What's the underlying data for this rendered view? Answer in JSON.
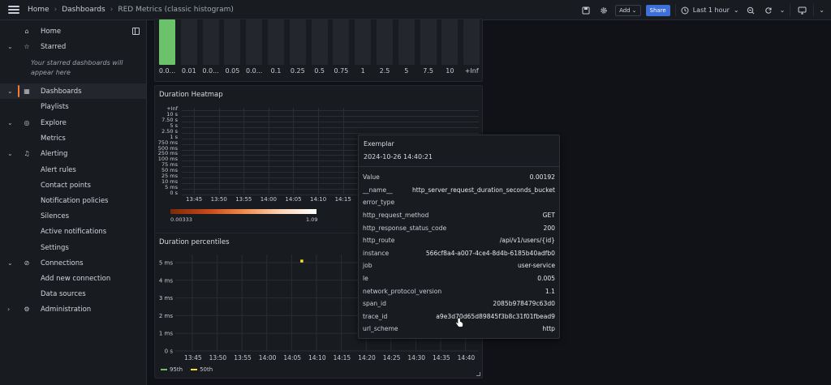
{
  "topbar": {
    "breadcrumbs": [
      "Home",
      "Dashboards",
      "RED Metrics (classic histogram)"
    ],
    "add_label": "Add",
    "share_label": "Share",
    "time_range": "Last 1 hour"
  },
  "sidebar": {
    "starred_note": "Your starred dashboards will appear here",
    "items": [
      {
        "label": "Home"
      },
      {
        "label": "Starred"
      },
      {
        "label": "Dashboards"
      },
      {
        "label": "Playlists"
      },
      {
        "label": "Explore"
      },
      {
        "label": "Metrics"
      },
      {
        "label": "Alerting"
      },
      {
        "label": "Alert rules"
      },
      {
        "label": "Contact points"
      },
      {
        "label": "Notification policies"
      },
      {
        "label": "Silences"
      },
      {
        "label": "Active notifications"
      },
      {
        "label": "Settings"
      },
      {
        "label": "Connections"
      },
      {
        "label": "Add new connection"
      },
      {
        "label": "Data sources"
      },
      {
        "label": "Administration"
      }
    ]
  },
  "bucket_panel": {
    "labels": [
      "0.0...",
      "0.01",
      "0.0...",
      "0.05",
      "0.0...",
      "0.1",
      "0.25",
      "0.5",
      "0.75",
      "1",
      "2.5",
      "5",
      "7.5",
      "10",
      "+Inf"
    ],
    "fills": [
      1,
      0,
      0,
      0,
      0,
      0,
      0,
      0,
      0,
      0,
      0,
      0,
      0,
      0,
      0
    ]
  },
  "heatmap": {
    "title": "Duration Heatmap",
    "yticks": [
      "+Inf",
      "10 s",
      "7.50 s",
      "5 s",
      "2.50 s",
      "1 s",
      "750 ms",
      "500 ms",
      "250 ms",
      "100 ms",
      "75 ms",
      "50 ms",
      "25 ms",
      "10 ms",
      "5 ms",
      "0 s"
    ],
    "xticks": [
      "13:45",
      "13:50",
      "13:55",
      "14:00",
      "14:05",
      "14:10",
      "14:15"
    ],
    "scale_min": "0.00333",
    "scale_max": "1.09"
  },
  "percentiles": {
    "title": "Duration percentiles",
    "yticks": [
      "5 ms",
      "4 ms",
      "3 ms",
      "2 ms",
      "1 ms",
      "0 s"
    ],
    "xticks": [
      "13:45",
      "13:50",
      "13:55",
      "14:00",
      "14:05",
      "14:10",
      "14:15",
      "14:20",
      "14:25",
      "14:30",
      "14:35",
      "14:40"
    ],
    "legend": [
      {
        "name": "95th",
        "color": "#73bf69"
      },
      {
        "name": "50th",
        "color": "#fade2a"
      }
    ]
  },
  "chart_data": {
    "type": "scatter",
    "yticks": [
      "5 ms",
      "4 ms",
      "3 ms",
      "2 ms",
      "1 ms",
      "0 s"
    ],
    "xticks": [
      "13:45",
      "13:50",
      "13:55",
      "14:00",
      "14:05",
      "14:10",
      "14:15",
      "14:20",
      "14:25",
      "14:30",
      "14:35",
      "14:40"
    ],
    "series": [
      {
        "name": "95th",
        "color": "#73bf69",
        "points": [
          [
            "14:40",
            "1.9 ms"
          ]
        ]
      },
      {
        "name": "50th",
        "color": "#fade2a",
        "points": [
          [
            "14:07",
            "5.1 ms"
          ],
          [
            "14:40",
            "1.8 ms"
          ]
        ]
      }
    ]
  },
  "tooltip": {
    "title": "Exemplar",
    "timestamp": "2024-10-26 14:40:21",
    "rows": [
      [
        "Value",
        "0.00192"
      ],
      [
        "__name__",
        "http_server_request_duration_seconds_bucket"
      ],
      [
        "error_type",
        ""
      ],
      [
        "http_request_method",
        "GET"
      ],
      [
        "http_response_status_code",
        "200"
      ],
      [
        "http_route",
        "/api/v1/users/{id}"
      ],
      [
        "instance",
        "566cf8a4-a007-4ce4-8d4b-6185b40adfb0"
      ],
      [
        "job",
        "user-service"
      ],
      [
        "le",
        "0.005"
      ],
      [
        "network_protocol_version",
        "1.1"
      ],
      [
        "span_id",
        "2085b978479c63d0"
      ],
      [
        "trace_id",
        "a9e3d70d65d89845f3b8c31f01fbead9"
      ],
      [
        "url_scheme",
        "http"
      ]
    ]
  }
}
